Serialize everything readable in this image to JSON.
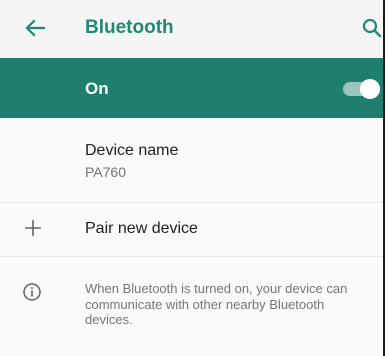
{
  "app_bar": {
    "title": "Bluetooth",
    "back_icon": "arrow-left-icon",
    "search_icon": "search-icon",
    "accent_color": "#1e8a73"
  },
  "master_switch": {
    "label": "On",
    "state": "on",
    "bar_color": "#1e7f6e"
  },
  "settings": {
    "device_name": {
      "title": "Device name",
      "value": "PA760"
    },
    "pair_new_device": {
      "label": "Pair new device",
      "icon": "plus-icon"
    },
    "info": {
      "icon": "info-icon",
      "text": "When Bluetooth is turned on, your device can communicate with other nearby Bluetooth devices."
    }
  }
}
